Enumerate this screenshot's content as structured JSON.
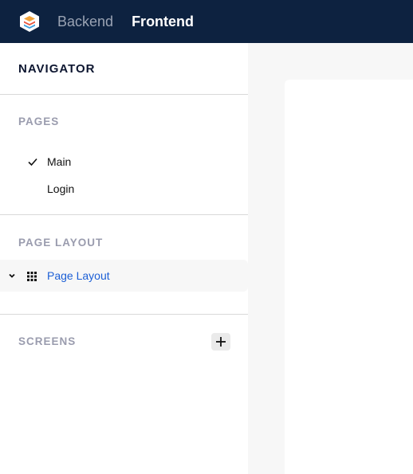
{
  "topbar": {
    "logo_icon": "stacked-layers-logo",
    "tabs": [
      {
        "label": "Backend",
        "active": false
      },
      {
        "label": "Frontend",
        "active": true
      }
    ]
  },
  "sidebar": {
    "title": "NAVIGATOR",
    "pages": {
      "label": "PAGES",
      "items": [
        {
          "label": "Main",
          "selected": true
        },
        {
          "label": "Login",
          "selected": false
        }
      ]
    },
    "page_layout": {
      "label": "PAGE LAYOUT",
      "item": {
        "label": "Page Layout",
        "icon": "grid-icon",
        "expand_icon": "chevron-down-icon"
      }
    },
    "screens": {
      "label": "SCREENS",
      "add_icon": "plus-icon"
    }
  },
  "colors": {
    "topbar_bg": "#0d2240",
    "accent_blue": "#1c5fd6",
    "section_label": "#9a9cae"
  }
}
